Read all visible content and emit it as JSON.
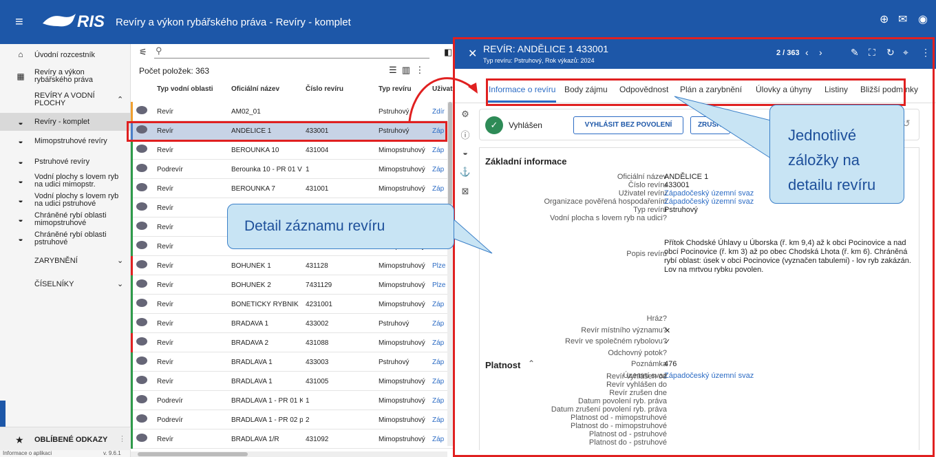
{
  "app": {
    "logo_text": "RIS",
    "title": "Revíry a výkon rybářského práva - Revíry - komplet"
  },
  "sidebar": {
    "items": [
      {
        "label": "Úvodní rozcestník",
        "icon": "home-icon"
      },
      {
        "label": "Revíry a výkon rybářského práva",
        "icon": "grid-icon"
      },
      {
        "label": "REVÍRY A VODNÍ PLOCHY",
        "icon": "chevron-up-icon"
      },
      {
        "label": "Revíry - komplet",
        "icon": "fish-icon"
      },
      {
        "label": "Mimopstruhové revíry",
        "icon": "fish-icon"
      },
      {
        "label": "Pstruhové revíry",
        "icon": "fish-icon"
      },
      {
        "label": "Vodní plochy s lovem ryb na udici mimopstr.",
        "icon": "fish-icon"
      },
      {
        "label": "Vodní plochy s lovem ryb na udici pstruhové",
        "icon": "fish-icon"
      },
      {
        "label": "Chráněné rybí oblasti mimopstruhové",
        "icon": "fish-icon"
      },
      {
        "label": "Chráněné rybí oblasti pstruhové",
        "icon": "fish-icon"
      },
      {
        "label": "ZARYBNĚNÍ",
        "icon": "chevron-down-icon"
      },
      {
        "label": "ČÍSELNÍKY",
        "icon": "chevron-down-icon"
      }
    ],
    "favorites": "OBLÍBENÉ ODKAZY",
    "footer_left": "Informace o aplikaci",
    "footer_right": "v. 9.6.1"
  },
  "list": {
    "count": "Počet položek: 363",
    "columns": [
      "Typ vodní oblasti",
      "Oficiální název",
      "Číslo revíru",
      "Typ revíru",
      "Uživate"
    ],
    "rows": [
      [
        "Revír",
        "AM02_01",
        "",
        "Pstruhový",
        "Ždír"
      ],
      [
        "Revír",
        "ANDĚLICE 1",
        "433001",
        "Pstruhový",
        "Záp"
      ],
      [
        "Revír",
        "BEROUNKA 10",
        "431004",
        "Mimopstruhový",
        "Záp"
      ],
      [
        "Podrevír",
        "Berounka 10 - PR 01 V ...",
        "1",
        "Mimopstruhový",
        "Záp"
      ],
      [
        "Revír",
        "BEROUNKA 7",
        "431001",
        "Mimopstruhový",
        "Záp"
      ],
      [
        "Revír",
        "",
        "",
        "",
        ""
      ],
      [
        "Revír",
        "",
        "",
        "",
        ""
      ],
      [
        "Revír",
        "BOHUNĚK 1",
        "7431127",
        "Mimopstruhový",
        "P"
      ],
      [
        "Revír",
        "BOHUNĚK 1",
        "431128",
        "Mimopstruhový",
        "Plze"
      ],
      [
        "Revír",
        "BOHUNĚK 2",
        "7431129",
        "Mimopstruhový",
        "Plze"
      ],
      [
        "Revír",
        "BONĚTICKÝ RYBNÍK",
        "4231001",
        "Mimopstruhový",
        "Záp"
      ],
      [
        "Revír",
        "BRADAVA 1",
        "433002",
        "Pstruhový",
        "Záp"
      ],
      [
        "Revír",
        "BRADAVA 2",
        "431088",
        "Mimopstruhový",
        "Záp"
      ],
      [
        "Revír",
        "BRADLAVA 1",
        "433003",
        "Pstruhový",
        "Záp"
      ],
      [
        "Revír",
        "BRADLAVA 1",
        "431005",
        "Mimopstruhový",
        "Záp"
      ],
      [
        "Podrevír",
        "BRADLAVA 1 - PR 01 K...",
        "1",
        "Mimopstruhový",
        "Záp"
      ],
      [
        "Podrevír",
        "BRADLAVA 1 - PR 02 p...",
        "2",
        "Mimopstruhový",
        "Záp"
      ],
      [
        "Revír",
        "BRADLAVA 1/R",
        "431092",
        "Mimopstruhový",
        "Záp"
      ]
    ]
  },
  "detail": {
    "title": "REVÍR: ANDĚLICE 1 433001",
    "subtitle": "Typ revíru: Pstruhový, Rok výkazů: 2024",
    "pager": "2 / 363",
    "tabs": [
      "Informace o revíru",
      "Body zájmu",
      "Odpovědnost",
      "Plán a zarybnění",
      "Úlovky a úhyny",
      "Listiny",
      "Bližší podmínky"
    ],
    "status": "Vyhlášen",
    "btn_declare": "VYHLÁSIT BEZ POVOLENÍ",
    "btn_cancel": "ZRUŠIT",
    "section_basic": "Základní informace",
    "section_validity": "Platnost",
    "fields": [
      {
        "label": "Oficiální název",
        "value": "ANDĚLICE 1"
      },
      {
        "label": "Číslo revíru",
        "value": "433001"
      },
      {
        "label": "Uživatel revíru",
        "value": "Západočeský územní svaz"
      },
      {
        "label": "Organizace pověřená hospodařením",
        "value": "Západočeský územní svaz"
      },
      {
        "label": "Typ revíru",
        "value": "Pstruhový"
      },
      {
        "label": "Vodní plocha s lovem ryb na udici?",
        "value": ""
      }
    ],
    "popis_label": "Popis revíru",
    "popis_value": "Přítok Chodské Úhlavy u Úborska (ř. km 9,4) až k obci Pocinovice a nad obcí Pocinovice (ř. km 3) až po obec Chodská Lhota (ř. km 6). Chráněná rybí oblast: úsek v obci Pocinovice (vyznačen tabulemi) - lov ryb zakázán. Lov na mrtvou rybku povolen.",
    "fields2": [
      {
        "label": "Hráz?",
        "value": ""
      },
      {
        "label": "Revír místního významu?",
        "value": "✕"
      },
      {
        "label": "Revír ve společném rybolovu?",
        "value": "✓"
      },
      {
        "label": "Odchovný potok?",
        "value": ""
      },
      {
        "label": "Poznámka",
        "value": "476"
      },
      {
        "label": "Územní svaz",
        "value": "Západočeský územní svaz"
      }
    ],
    "validity_labels": [
      "Revír vyhlášen od",
      "Revír vyhlášen do",
      "Revír zrušen dne",
      "Datum povolení ryb. práva",
      "Datum zrušení povolení ryb. práva",
      "Platnost od - mimopstruhové",
      "Platnost do - mimopstruhové",
      "Platnost od - pstruhové",
      "Platnost do - pstruhové"
    ]
  },
  "callouts": {
    "tabs_note": "Jednotlivé záložky na detailu revíru",
    "detail_note": "Detail záznamu revíru"
  },
  "colors": {
    "primary": "#1d57a8",
    "highlight": "#e02020",
    "callout": "#c8e4f4"
  }
}
